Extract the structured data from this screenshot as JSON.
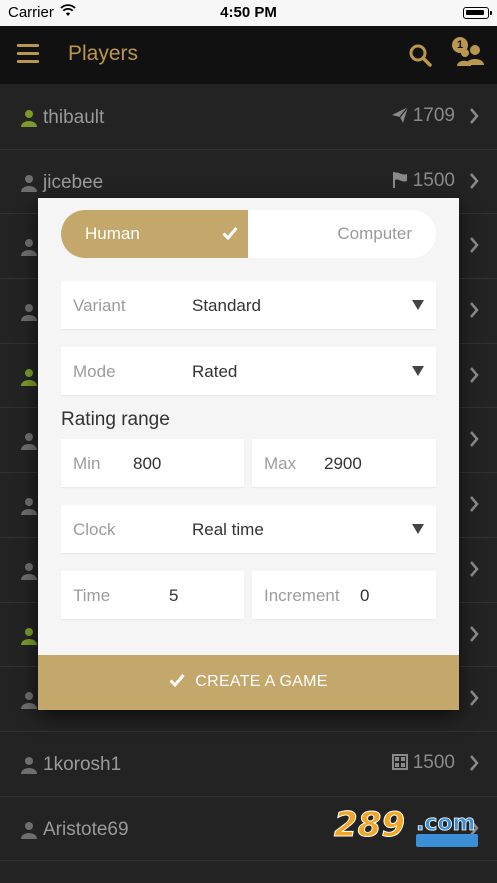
{
  "status_bar": {
    "carrier": "Carrier",
    "time": "4:50 PM"
  },
  "header": {
    "title": "Players",
    "badge_count": "1"
  },
  "players": [
    {
      "name": "thibault",
      "rating": "1709",
      "perf_icon": "paper-plane-icon",
      "online": true
    },
    {
      "name": "jicebee",
      "rating": "1500",
      "perf_icon": "flag-icon",
      "online": false
    },
    {
      "name": "",
      "rating": "",
      "perf_icon": "",
      "online": false
    },
    {
      "name": "",
      "rating": "",
      "perf_icon": "",
      "online": false
    },
    {
      "name": "",
      "rating": "",
      "perf_icon": "",
      "online": true
    },
    {
      "name": "",
      "rating": "",
      "perf_icon": "",
      "online": false
    },
    {
      "name": "",
      "rating": "",
      "perf_icon": "",
      "online": false
    },
    {
      "name": "",
      "rating": "",
      "perf_icon": "",
      "online": false
    },
    {
      "name": "",
      "rating": "",
      "perf_icon": "",
      "online": true
    },
    {
      "name": "",
      "rating": "",
      "perf_icon": "",
      "online": false
    },
    {
      "name": "1korosh1",
      "rating": "1500",
      "perf_icon": "grid-icon",
      "online": false
    },
    {
      "name": "Aristote69",
      "rating": "",
      "perf_icon": "",
      "online": false
    }
  ],
  "modal": {
    "toggle": {
      "human": "Human",
      "computer": "Computer"
    },
    "variant": {
      "label": "Variant",
      "value": "Standard"
    },
    "mode": {
      "label": "Mode",
      "value": "Rated"
    },
    "rating_range_title": "Rating range",
    "min": {
      "label": "Min",
      "value": "800"
    },
    "max": {
      "label": "Max",
      "value": "2900"
    },
    "clock": {
      "label": "Clock",
      "value": "Real time"
    },
    "time": {
      "label": "Time",
      "value": "5"
    },
    "increment": {
      "label": "Increment",
      "value": "0"
    },
    "create_label": "CREATE A GAME"
  },
  "colors": {
    "accent": "#c4a76a",
    "header_accent": "#b9974f",
    "online": "#7a9a2a"
  }
}
